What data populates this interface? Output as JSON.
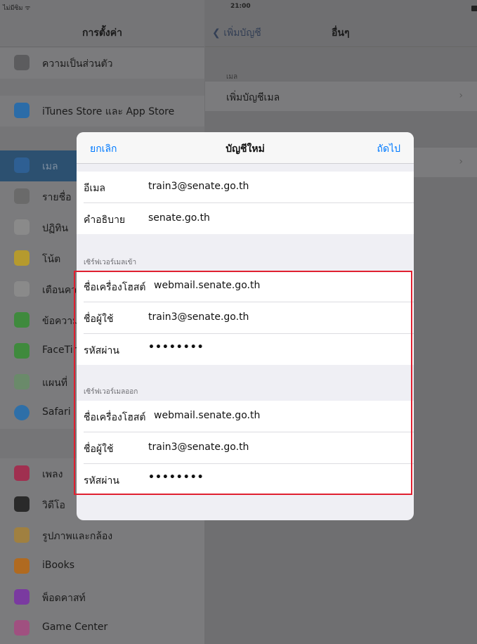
{
  "status": {
    "carrier": "ไม่มีซิม ᯤ",
    "time": "21:00",
    "battery": "70%"
  },
  "left": {
    "title": "การตั้งค่า",
    "items": [
      {
        "label": "ความเป็นส่วนตัว",
        "icon": "privacy-icon",
        "color": "#5c5c5e"
      },
      {
        "label": "iTunes Store และ App Store",
        "icon": "app-store-icon",
        "color": "#2b6ca8"
      },
      {
        "label": "เมล",
        "icon": "mail-icon",
        "color": "#2e5f93"
      },
      {
        "label": "รายชื่อ",
        "icon": "contacts-icon",
        "color": "#6a6a6a"
      },
      {
        "label": "ปฏิทิน",
        "icon": "calendar-icon",
        "color": "#8a8a8a"
      },
      {
        "label": "โน้ต",
        "icon": "notes-icon",
        "color": "#b59a2e"
      },
      {
        "label": "เตือนคว",
        "icon": "reminders-icon",
        "color": "#8a8a8a"
      },
      {
        "label": "ข้อความ",
        "icon": "messages-icon",
        "color": "#3f8a3d"
      },
      {
        "label": "FaceTir",
        "icon": "facetime-icon",
        "color": "#3f8a3d"
      },
      {
        "label": "แผนที่",
        "icon": "maps-icon",
        "color": "#6a8a6a"
      },
      {
        "label": "Safari",
        "icon": "safari-icon",
        "color": "#2e6fa8"
      },
      {
        "label": "เพลง",
        "icon": "music-icon",
        "color": "#a03050"
      },
      {
        "label": "วิดีโอ",
        "icon": "videos-icon",
        "color": "#2a2a2a"
      },
      {
        "label": "รูปภาพและกล้อง",
        "icon": "photos-icon",
        "color": "#a08040"
      },
      {
        "label": "iBooks",
        "icon": "ibooks-icon",
        "color": "#b06a20"
      },
      {
        "label": "พ็อดคาสท์",
        "icon": "podcasts-icon",
        "color": "#7a3aa0"
      },
      {
        "label": "Game Center",
        "icon": "game-center-icon",
        "color": "#a05080"
      }
    ]
  },
  "right": {
    "back_label": "เพิ่มบัญชี",
    "title": "อื่นๆ",
    "section_label": "เมล",
    "add_mail_label": "เพิ่มบัญชีเมล"
  },
  "modal": {
    "cancel_label": "ยกเลิก",
    "title": "บัญชีใหม่",
    "next_label": "ถัดไป",
    "account": [
      {
        "key": "อีเมล",
        "value": "train3@senate.go.th"
      },
      {
        "key": "คำอธิบาย",
        "value": "senate.go.th"
      }
    ],
    "incoming_label": "เซิร์ฟเวอร์เมลเข้า",
    "incoming": {
      "host_key": "ชื่อเครื่องโฮสต์",
      "host_value": "webmail.senate.go.th",
      "user_key": "ชื่อผู้ใช้",
      "user_value": "train3@senate.go.th",
      "pass_key": "รหัสผ่าน",
      "pass_value": "••••••••"
    },
    "outgoing_label": "เซิร์ฟเวอร์เมลออก",
    "outgoing": {
      "host_key": "ชื่อเครื่องโฮสต์",
      "host_value": "webmail.senate.go.th",
      "user_key": "ชื่อผู้ใช้",
      "user_value": "train3@senate.go.th",
      "pass_key": "รหัสผ่าน",
      "pass_value": "••••••••"
    }
  },
  "colors": {
    "accent": "#007aff",
    "highlight": "#e02030"
  }
}
